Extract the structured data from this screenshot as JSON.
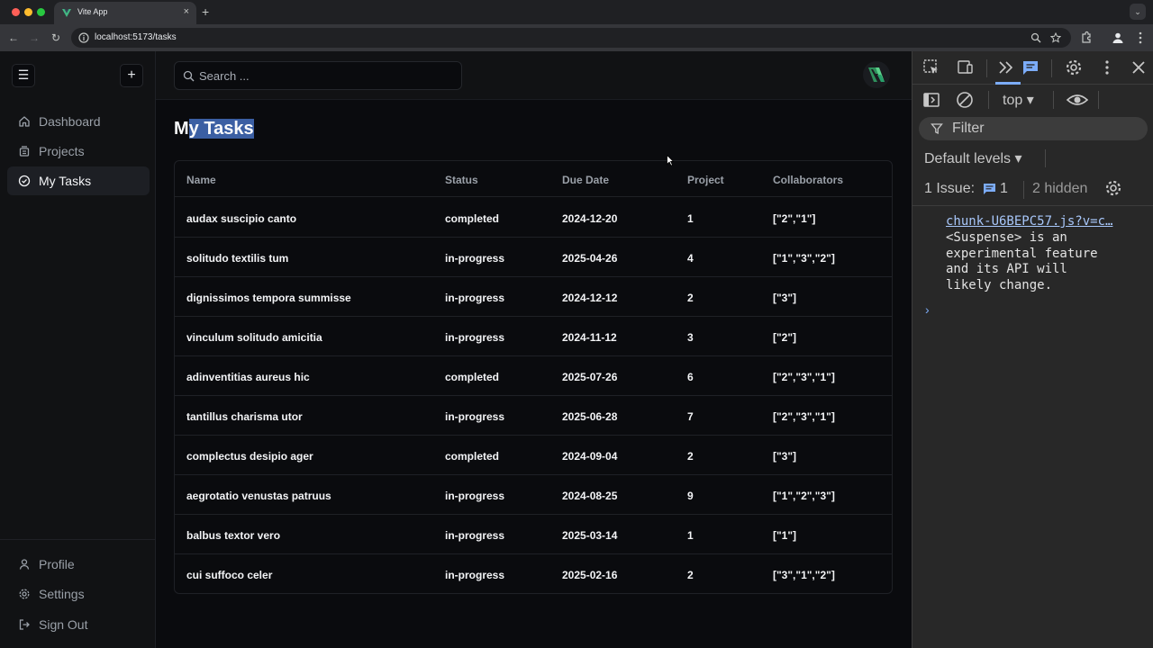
{
  "browser": {
    "tab_title": "Vite App",
    "tab_close": "×",
    "new_tab": "+",
    "tab_menu": "⌄",
    "url": "localhost:5173/tasks",
    "nav": {
      "back": "←",
      "forward": "→",
      "reload": "↻"
    }
  },
  "sidebar": {
    "menu_icon": "☰",
    "add_icon": "+",
    "items": [
      {
        "label": "Dashboard",
        "icon": "home-icon",
        "active": false
      },
      {
        "label": "Projects",
        "icon": "projects-icon",
        "active": false
      },
      {
        "label": "My Tasks",
        "icon": "task-check-icon",
        "active": true
      }
    ],
    "bottom_items": [
      {
        "label": "Profile",
        "icon": "user-icon"
      },
      {
        "label": "Settings",
        "icon": "gear-icon"
      },
      {
        "label": "Sign Out",
        "icon": "sign-out-icon"
      }
    ]
  },
  "header": {
    "search_placeholder": "Search ..."
  },
  "page": {
    "title_prefix": "M",
    "title_selected": "y Tasks"
  },
  "table": {
    "columns": [
      "Name",
      "Status",
      "Due Date",
      "Project",
      "Collaborators"
    ],
    "rows": [
      {
        "name": "audax suscipio canto",
        "status": "completed",
        "due": "2024-12-20",
        "project": "1",
        "collaborators": "[\"2\",\"1\"]"
      },
      {
        "name": "solitudo textilis tum",
        "status": "in-progress",
        "due": "2025-04-26",
        "project": "4",
        "collaborators": "[\"1\",\"3\",\"2\"]"
      },
      {
        "name": "dignissimos tempora summisse",
        "status": "in-progress",
        "due": "2024-12-12",
        "project": "2",
        "collaborators": "[\"3\"]"
      },
      {
        "name": "vinculum solitudo amicitia",
        "status": "in-progress",
        "due": "2024-11-12",
        "project": "3",
        "collaborators": "[\"2\"]"
      },
      {
        "name": "adinventitias aureus hic",
        "status": "completed",
        "due": "2025-07-26",
        "project": "6",
        "collaborators": "[\"2\",\"3\",\"1\"]"
      },
      {
        "name": "tantillus charisma utor",
        "status": "in-progress",
        "due": "2025-06-28",
        "project": "7",
        "collaborators": "[\"2\",\"3\",\"1\"]"
      },
      {
        "name": "complectus desipio ager",
        "status": "completed",
        "due": "2024-09-04",
        "project": "2",
        "collaborators": "[\"3\"]"
      },
      {
        "name": "aegrotatio venustas patruus",
        "status": "in-progress",
        "due": "2024-08-25",
        "project": "9",
        "collaborators": "[\"1\",\"2\",\"3\"]"
      },
      {
        "name": "balbus textor vero",
        "status": "in-progress",
        "due": "2025-03-14",
        "project": "1",
        "collaborators": "[\"1\"]"
      },
      {
        "name": "cui suffoco celer",
        "status": "in-progress",
        "due": "2025-02-16",
        "project": "2",
        "collaborators": "[\"3\",\"1\",\"2\"]"
      }
    ]
  },
  "devtools": {
    "context": "top",
    "filter_placeholder": "Filter",
    "levels": "Default levels",
    "issues_label": "1 Issue:",
    "issues_count": "1",
    "hidden": "2 hidden",
    "message_link": "chunk-U6BEPC57.js?v=c…",
    "message_lines": [
      "<Suspense> is an",
      "experimental feature",
      "and its API will",
      "likely change."
    ],
    "prompt": "›"
  },
  "colors": {
    "accent_selection": "#3b5fa3",
    "app_bg": "#0a0b0e",
    "sidebar_bg": "#111214",
    "devtools_bg": "#282828",
    "link": "#a8c7fa"
  }
}
